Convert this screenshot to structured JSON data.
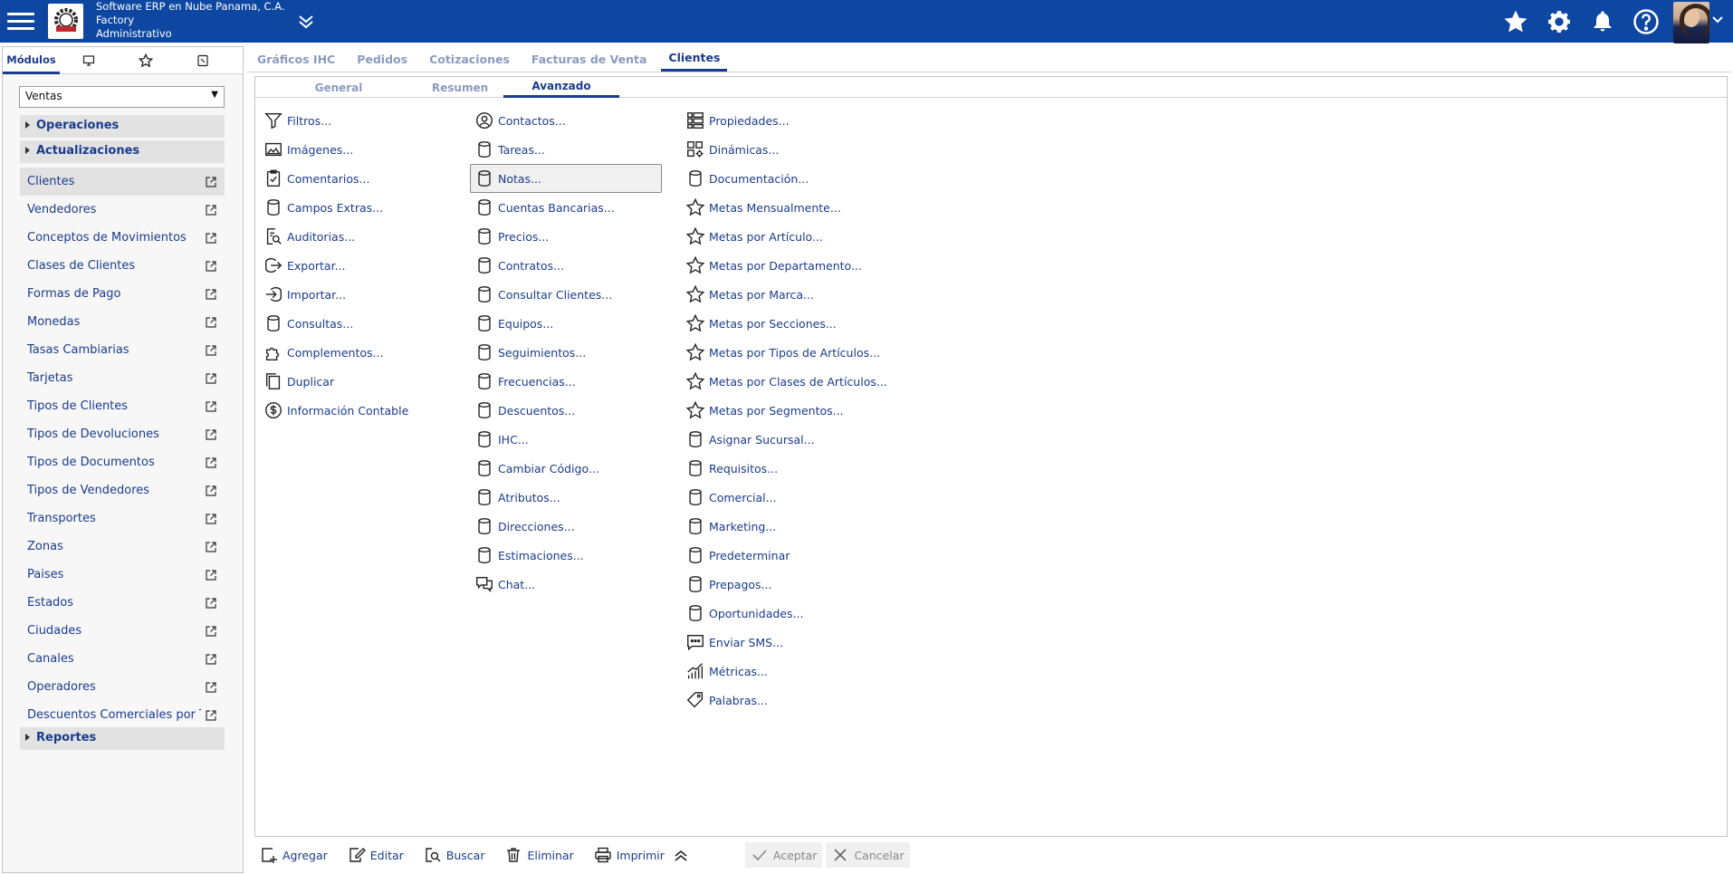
{
  "header": {
    "company_line1": "Software ERP en Nube Panama, C.A.",
    "company_line2": "Factory",
    "company_line3": "Administrativo",
    "icons": [
      "hamburger-icon",
      "company-logo",
      "chevron-double-down-icon",
      "star-icon",
      "gear-icon",
      "bell-icon",
      "help-icon",
      "avatar"
    ]
  },
  "left_panel": {
    "tabs": [
      {
        "label": "Módulos",
        "icon": null
      },
      {
        "label": "",
        "icon": "monitor-icon"
      },
      {
        "label": "",
        "icon": "star-outline-icon"
      },
      {
        "label": "",
        "icon": "clipboard-icon"
      }
    ],
    "module_select": "Ventas",
    "sections": {
      "operaciones": "Operaciones",
      "actualizaciones": "Actualizaciones",
      "reportes": "Reportes"
    },
    "items": [
      {
        "label": "Clientes",
        "selected": true
      },
      {
        "label": "Vendedores"
      },
      {
        "label": "Conceptos de Movimientos"
      },
      {
        "label": "Clases de Clientes"
      },
      {
        "label": "Formas de Pago"
      },
      {
        "label": "Monedas"
      },
      {
        "label": "Tasas Cambiarias"
      },
      {
        "label": "Tarjetas"
      },
      {
        "label": "Tipos de Clientes"
      },
      {
        "label": "Tipos de Devoluciones"
      },
      {
        "label": "Tipos de Documentos"
      },
      {
        "label": "Tipos de Vendedores"
      },
      {
        "label": "Transportes"
      },
      {
        "label": "Zonas"
      },
      {
        "label": "Paises"
      },
      {
        "label": "Estados"
      },
      {
        "label": "Ciudades"
      },
      {
        "label": "Canales"
      },
      {
        "label": "Operadores"
      },
      {
        "label": "Descuentos Comerciales por Tipo"
      }
    ]
  },
  "main_tabs": [
    {
      "label": "Gráficos IHC"
    },
    {
      "label": "Pedidos"
    },
    {
      "label": "Cotizaciones"
    },
    {
      "label": "Facturas de Venta"
    },
    {
      "label": "Clientes",
      "active": true
    }
  ],
  "sub_tabs": [
    {
      "label": "General"
    },
    {
      "label": "Resumen"
    },
    {
      "label": "Avanzado",
      "active": true
    }
  ],
  "actions": {
    "col1": [
      {
        "label": "Filtros...",
        "icon": "filter-icon"
      },
      {
        "label": "Imágenes...",
        "icon": "image-icon"
      },
      {
        "label": "Comentarios...",
        "icon": "clipboard-check-icon"
      },
      {
        "label": "Campos Extras...",
        "icon": "database-icon"
      },
      {
        "label": "Auditorias...",
        "icon": "audit-icon"
      },
      {
        "label": "Exportar...",
        "icon": "export-icon"
      },
      {
        "label": "Importar...",
        "icon": "import-icon"
      },
      {
        "label": "Consultas...",
        "icon": "database-icon"
      },
      {
        "label": "Complementos...",
        "icon": "puzzle-icon"
      },
      {
        "label": "Duplicar",
        "icon": "copy-icon"
      },
      {
        "label": "Información Contable",
        "icon": "dollar-circle-icon"
      }
    ],
    "col2": [
      {
        "label": "Contactos...",
        "icon": "user-circle-icon"
      },
      {
        "label": "Tareas...",
        "icon": "database-icon"
      },
      {
        "label": "Notas...",
        "icon": "database-icon",
        "focused": true
      },
      {
        "label": "Cuentas Bancarias...",
        "icon": "database-icon"
      },
      {
        "label": "Precios...",
        "icon": "database-icon"
      },
      {
        "label": "Contratos...",
        "icon": "database-icon"
      },
      {
        "label": "Consultar Clientes...",
        "icon": "database-icon"
      },
      {
        "label": "Equipos...",
        "icon": "database-icon"
      },
      {
        "label": "Seguimientos...",
        "icon": "database-icon"
      },
      {
        "label": "Frecuencias...",
        "icon": "database-icon"
      },
      {
        "label": "Descuentos...",
        "icon": "database-icon"
      },
      {
        "label": "IHC...",
        "icon": "database-icon"
      },
      {
        "label": "Cambiar Código...",
        "icon": "database-icon"
      },
      {
        "label": "Atributos...",
        "icon": "database-icon"
      },
      {
        "label": "Direcciones...",
        "icon": "database-icon"
      },
      {
        "label": "Estimaciones...",
        "icon": "database-icon"
      },
      {
        "label": "Chat...",
        "icon": "chat-icon"
      }
    ],
    "col3": [
      {
        "label": "Propiedades...",
        "icon": "grid-list-icon"
      },
      {
        "label": "Dinámicas...",
        "icon": "grid-gear-icon"
      },
      {
        "label": "Documentación...",
        "icon": "database-icon"
      },
      {
        "label": "Metas Mensualmente...",
        "icon": "star-outline-icon"
      },
      {
        "label": "Metas por Artículo...",
        "icon": "star-outline-icon"
      },
      {
        "label": "Metas por Departamento...",
        "icon": "star-outline-icon"
      },
      {
        "label": "Metas por Marca...",
        "icon": "star-outline-icon"
      },
      {
        "label": "Metas por Secciones...",
        "icon": "star-outline-icon"
      },
      {
        "label": "Metas por Tipos de Artículos...",
        "icon": "star-outline-icon"
      },
      {
        "label": "Metas por Clases de Artículos...",
        "icon": "star-outline-icon"
      },
      {
        "label": "Metas por Segmentos...",
        "icon": "star-outline-icon"
      },
      {
        "label": "Asignar Sucursal...",
        "icon": "database-icon"
      },
      {
        "label": "Requisitos...",
        "icon": "database-icon"
      },
      {
        "label": "Comercial...",
        "icon": "database-icon"
      },
      {
        "label": "Marketing...",
        "icon": "database-icon"
      },
      {
        "label": "Predeterminar",
        "icon": "database-icon"
      },
      {
        "label": "Prepagos...",
        "icon": "database-icon"
      },
      {
        "label": "Oportunidades...",
        "icon": "database-icon"
      },
      {
        "label": "Enviar SMS...",
        "icon": "chat-dots-icon"
      },
      {
        "label": "Métricas...",
        "icon": "metrics-icon"
      },
      {
        "label": "Palabras...",
        "icon": "tag-icon"
      }
    ]
  },
  "toolbar": {
    "add": "Agregar",
    "edit": "Editar",
    "search": "Buscar",
    "delete": "Eliminar",
    "print": "Imprimir",
    "accept": "Aceptar",
    "cancel": "Cancelar"
  },
  "colors": {
    "header_bg": "#0e47a1",
    "link": "#1a3c8c",
    "inactive_tab": "#8a9bbf"
  }
}
